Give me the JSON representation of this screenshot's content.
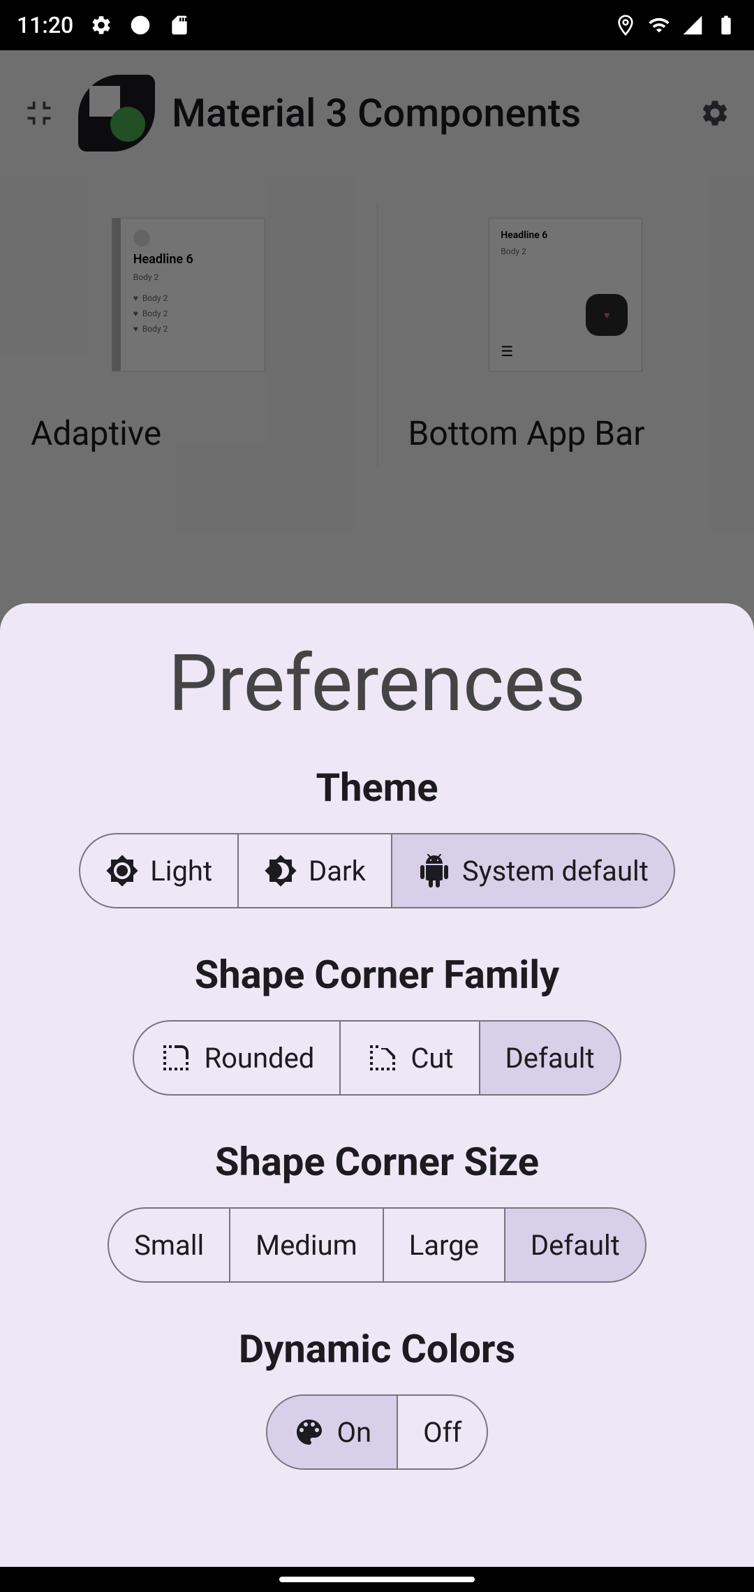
{
  "status": {
    "time": "11:20",
    "icons_left": [
      "gear-icon",
      "circle-icon",
      "sd-icon"
    ],
    "icons_right": [
      "location-icon",
      "wifi-icon",
      "cell-icon",
      "battery-icon"
    ]
  },
  "background": {
    "app_title": "Material 3 Components",
    "cards": [
      {
        "preview_headline": "Headline 6",
        "preview_body": "Body 2",
        "preview_lines": [
          "Body 2",
          "Body 2",
          "Body 2"
        ],
        "label": "Adaptive"
      },
      {
        "preview_headline": "Headline 6",
        "preview_body": "Body 2",
        "label": "Bottom App Bar"
      }
    ]
  },
  "sheet": {
    "title": "Preferences",
    "sections": {
      "theme": {
        "title": "Theme",
        "options": [
          {
            "icon": "brightness",
            "label": "Light",
            "selected": false
          },
          {
            "icon": "dark-mode",
            "label": "Dark",
            "selected": false
          },
          {
            "icon": "android",
            "label": "System default",
            "selected": true
          }
        ]
      },
      "shape_family": {
        "title": "Shape Corner Family",
        "options": [
          {
            "icon": "rounded-corner",
            "label": "Rounded",
            "selected": false
          },
          {
            "icon": "cut-corner",
            "label": "Cut",
            "selected": false
          },
          {
            "icon": null,
            "label": "Default",
            "selected": true
          }
        ]
      },
      "shape_size": {
        "title": "Shape Corner Size",
        "options": [
          {
            "label": "Small",
            "selected": false
          },
          {
            "label": "Medium",
            "selected": false
          },
          {
            "label": "Large",
            "selected": false
          },
          {
            "label": "Default",
            "selected": true
          }
        ]
      },
      "dynamic_colors": {
        "title": "Dynamic Colors",
        "options": [
          {
            "icon": "palette",
            "label": "On",
            "selected": true
          },
          {
            "icon": null,
            "label": "Off",
            "selected": false
          }
        ]
      }
    }
  }
}
